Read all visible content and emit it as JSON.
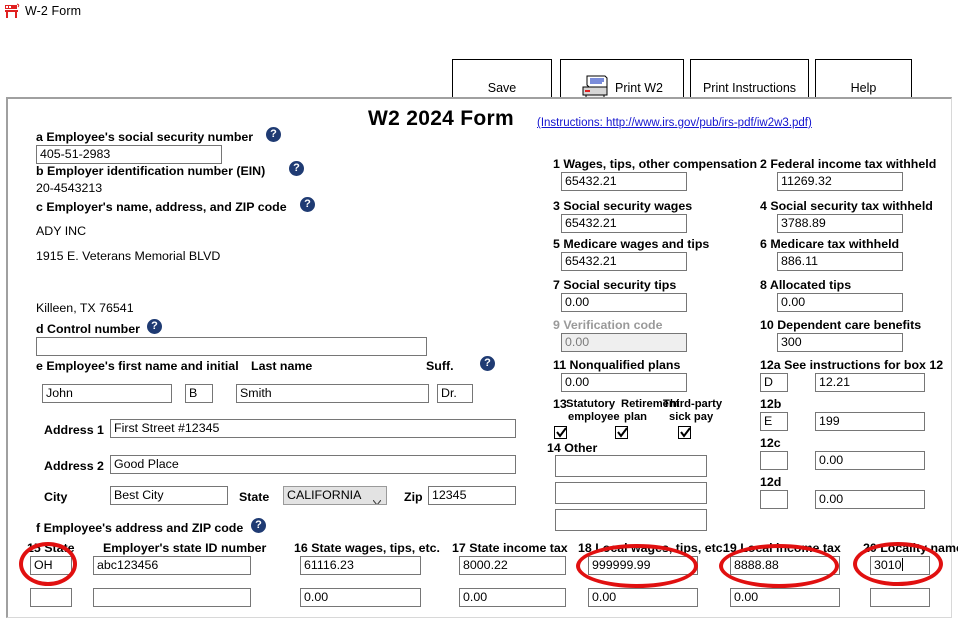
{
  "window": {
    "title": "W-2 Form",
    "icon": "w2-form-icon"
  },
  "toolbar": {
    "save_label": "Save",
    "print_w2_label": "Print W2",
    "print_instructions_label": "Print Instructions",
    "help_label": "Help",
    "printer_icon": "printer-icon"
  },
  "form": {
    "title": "W2 2024 Form",
    "instructions_link": "(Instructions: http://www.irs.gov/pub/irs-pdf/iw2w3.pdf)",
    "help_glyph": "?"
  },
  "left": {
    "a_label": "a  Employee's social security number",
    "a_value": "405-51-2983",
    "b_label": "b  Employer identification number (EIN)",
    "b_value": "20-4543213",
    "c_label": "c  Employer's name, address, and ZIP code",
    "c_employer_name": "ADY INC",
    "c_employer_address": "1915 E. Veterans Memorial BLVD",
    "c_employer_citystatezip": "Killeen, TX 76541",
    "d_label": "d  Control number",
    "d_value": "",
    "e_label_first": "e  Employee's first name and initial",
    "e_label_last": "Last name",
    "e_label_suffix": "Suff.",
    "e_first_name": "John",
    "e_initial": "B",
    "e_last_name": "Smith",
    "e_suffix": "Dr.",
    "address1_label": "Address 1",
    "address1_value": "First Street #12345",
    "address2_label": "Address 2",
    "address2_value": "Good Place",
    "city_label": "City",
    "city_value": "Best City",
    "state_label": "State",
    "state_value": "CALIFORNIA",
    "zip_label": "Zip",
    "zip_value": "12345",
    "f_label": "f  Employee's address and ZIP code"
  },
  "boxes": {
    "b1_label": "1 Wages, tips, other compensation",
    "b1_value": "65432.21",
    "b2_label": "2 Federal income tax withheld",
    "b2_value": "11269.32",
    "b3_label": "3 Social security wages",
    "b3_value": "65432.21",
    "b4_label": "4 Social security tax withheld",
    "b4_value": "3788.89",
    "b5_label": "5 Medicare wages and tips",
    "b5_value": "65432.21",
    "b6_label": "6 Medicare tax withheld",
    "b6_value": "886.11",
    "b7_label": "7 Social security tips",
    "b7_value": "0.00",
    "b8_label": "8 Allocated tips",
    "b8_value": "0.00",
    "b9_label": "9 Verification code",
    "b9_value": "0.00",
    "b10_label": "10 Dependent care benefits",
    "b10_value": "300",
    "b11_label": "11 Nonqualified plans",
    "b11_value": "0.00",
    "b12a_label": "12a See instructions for box 12",
    "b12a_code": "D",
    "b12a_value": "12.21",
    "b12b_label": "12b",
    "b12b_code": "E",
    "b12b_value": "199",
    "b12c_label": "12c",
    "b12c_code": "",
    "b12c_value": "0.00",
    "b12d_label": "12d",
    "b12d_code": "",
    "b12d_value": "0.00",
    "b13_label": "13",
    "b13_statutory_l1": "Statutory",
    "b13_statutory_l2": "employee",
    "b13_retirement_l1": "Retirement",
    "b13_retirement_l2": "plan",
    "b13_thirdparty_l1": "Third-party",
    "b13_thirdparty_l2": "sick pay",
    "b13_statutory_checked": true,
    "b13_retirement_checked": true,
    "b13_thirdparty_checked": true,
    "b14_label": "14 Other",
    "b14_value1": "",
    "b14_value2": "",
    "b14_value3": ""
  },
  "statelocal": {
    "b15_label": "15 State",
    "b15_employer_state_id_label": "Employer's state ID number",
    "b16_label": "16 State wages, tips, etc.",
    "b17_label": "17 State income tax",
    "b18_label": "18 Local wages, tips, etc.",
    "b19_label": "19 Local income tax",
    "b20_label": "20 Locality name",
    "row1": {
      "state": "OH",
      "employer_state_id": "abc123456",
      "state_wages": "61116.23",
      "state_income_tax": "8000.22",
      "local_wages": "999999.99",
      "local_income_tax": "8888.88",
      "locality_name": "3010"
    },
    "row2": {
      "state": "",
      "employer_state_id": "",
      "state_wages": "0.00",
      "state_income_tax": "0.00",
      "local_wages": "0.00",
      "local_income_tax": "0.00",
      "locality_name": ""
    }
  },
  "annotations": {
    "highlight_color": "#e11010",
    "circled_fields": [
      "15-state",
      "18-local-wages",
      "19-local-income-tax",
      "20-locality-name"
    ]
  }
}
